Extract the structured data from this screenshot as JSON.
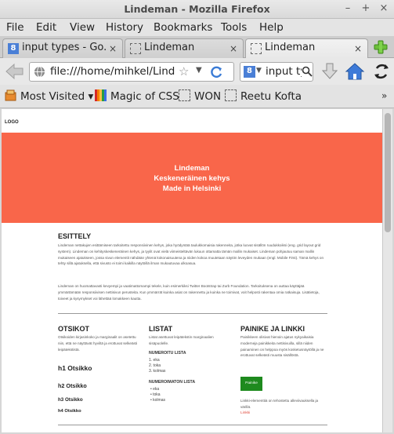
{
  "window": {
    "title": "Lindeman - Mozilla Firefox",
    "minimize": "–",
    "maximize": "+",
    "close": "×"
  },
  "menu": [
    "File",
    "Edit",
    "View",
    "History",
    "Bookmarks",
    "Tools",
    "Help"
  ],
  "tabs": [
    {
      "label": "input types - Go...",
      "icon": "google-g-icon",
      "icon_text": "8"
    },
    {
      "label": "Lindeman",
      "icon": "blank-page-icon"
    },
    {
      "label": "Lindeman",
      "icon": "blank-page-icon",
      "active": true
    }
  ],
  "navbar": {
    "url": "file:///home/mihkel/Lindeman",
    "search_value": "input ty",
    "search_icon_text": "8"
  },
  "bookmarks": [
    {
      "label": "Most Visited",
      "icon": "most-visited-icon",
      "dropdown": "▾"
    },
    {
      "label": "Magic of CSS",
      "icon": "rainbow-icon"
    },
    {
      "label": "WON",
      "icon": "blank-page-icon"
    },
    {
      "label": "Reetu Kofta",
      "icon": "blank-page-icon"
    }
  ],
  "bookmarks_overflow": "»",
  "colors": {
    "hero": "#f9664a",
    "button_green": "#1e8a1e",
    "link_red": "#e0473a"
  },
  "page": {
    "logo": "LOGO",
    "hero": [
      "Lindeman",
      "Keskeneräinen kehys",
      "Made in Helsinki"
    ],
    "esittely": {
      "title": "ESITTELY",
      "p1": "Lindeman nettakujen esittämiseen tarkoitettu responsiivinen kehys, joka hyödyntää taulukkomaisia rakenneita, jotka luovat sisällön ruudukkoiksi (eng. grid layout grid system). Lindeman on kehityskeskeneräinen kehys, ja tyylit ovat vielä viimeisteltävän lukuun ottamatta tämän mallin mukaiset. Lindeman pohjautuu saman mallin mukaiseen ajatukseen, jossa sivun elementit nähdään yhtenä kokonaisuutena ja niiden kokoa muutetaan näytön leveyden mukaan (engl. Mobile First). Tämä kehys on tehty sillä ajatuksella, että sivusto ei toimi kaikilla näytöillä ilman mukautuvaa ulkoasua.",
      "p2": "Lindeman on huomattavasti kevyempi ja vaatimattomampi tekele, kuin esimerkiksi Twitter Bootstrap tai Zurb Foundation. Tarkoituksena on auttaa käyttäjää ymmärtämään responsiivisen nettisivun perusteita. Kun ymmärrät kuinka asiat on rakennettu ja kuinka ne toimivat, voit helposti rakentaa omia ratkaisuja. Lisätietoja, toiveet ja kysymykset voi lähettää lomakkeen kautta."
    },
    "otsikot": {
      "title": "OTSIKOT",
      "desc": "Otsikoiden kirjasinkoko ja marginaalit on asetettu niin, että ne näyttävät hyviltä ja erottuvat selkeästi leipätekstistä.",
      "h1": "h1 Otsikko",
      "h2": "h2 Otsikko",
      "h3": "h3 Otsikko",
      "h4": "h4 Otsikko"
    },
    "listat": {
      "title": "LISTAT",
      "desc": "Listat asettuvat leipätekstin marginaalien sisäpuolelle.",
      "ordered_title": "NUMEROITU LISTA",
      "ordered": [
        "1.  eka",
        "2.  toka",
        "3.  kolmas"
      ],
      "unordered_title": "NUMEROIMATON LISTA",
      "unordered": [
        "•  eka",
        "•  toka",
        "•  kolmas"
      ]
    },
    "painike": {
      "title": "PAINIKE JA LINKKI",
      "desc": "Painikkeen olisivat hienoin ajatus nykyaikaisia moderneja painikkeita nettisivuilla, sillä niiden painaminen on helppoa myös kosketusnäytöllä ja ne erottuvat selkeästi muusta sisällöstä.",
      "button": "Painike",
      "link_desc": "Linkki-elementtiä on tehostettu alleviivauksella ja värillä.",
      "link": "Linkki"
    }
  }
}
